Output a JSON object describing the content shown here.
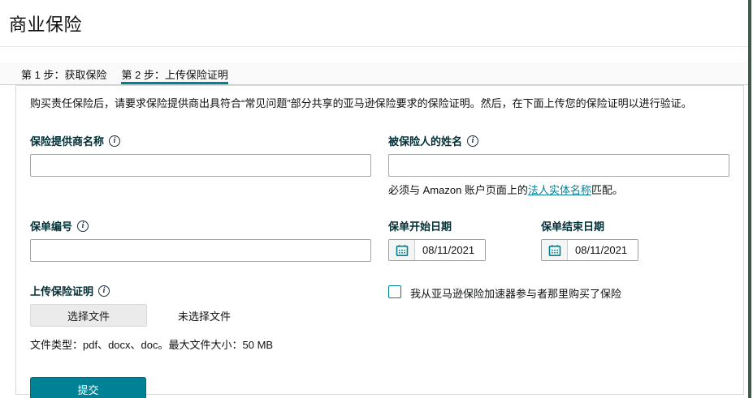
{
  "page": {
    "title": "商业保险"
  },
  "colors": {
    "accent": "#008296",
    "edge": "#3e584a",
    "label": "#002f36",
    "text": "#0f1111",
    "input-border": "#a2a6a6",
    "card-border": "#d5d9d9",
    "strip-bg": "#fafafa"
  },
  "icons": {
    "info": "i"
  },
  "tabs": [
    {
      "label": "第 1 步：获取保险",
      "active": false
    },
    {
      "label": "第 2 步：上传保险证明",
      "active": true
    }
  ],
  "panel": {
    "description": "购买责任保险后，请要求保险提供商出具符合“常见问题”部分共享的亚马逊保险要求的保险证明。然后，在下面上传您的保险证明以进行验证。",
    "fields": {
      "provider_name": {
        "label": "保险提供商名称",
        "value": ""
      },
      "insured_name": {
        "label": "被保险人的姓名",
        "value": "",
        "helper_prefix": "必须与 Amazon 账户页面上的",
        "helper_link": "法人实体名称",
        "helper_suffix": "匹配。"
      },
      "policy_number": {
        "label": "保单编号",
        "value": ""
      },
      "policy_start": {
        "label": "保单开始日期",
        "value": "08/11/2021"
      },
      "policy_end": {
        "label": "保单结束日期",
        "value": "08/11/2021"
      },
      "upload": {
        "label": "上传保险证明",
        "button_label": "选择文件",
        "no_file_text": "未选择文件",
        "hint": "文件类型：pdf、docx、doc。最大文件大小：50 MB"
      },
      "accelerator_checkbox": {
        "label": "我从亚马逊保险加速器参与者那里购买了保险",
        "checked": false
      }
    },
    "submit_label": "提交"
  }
}
